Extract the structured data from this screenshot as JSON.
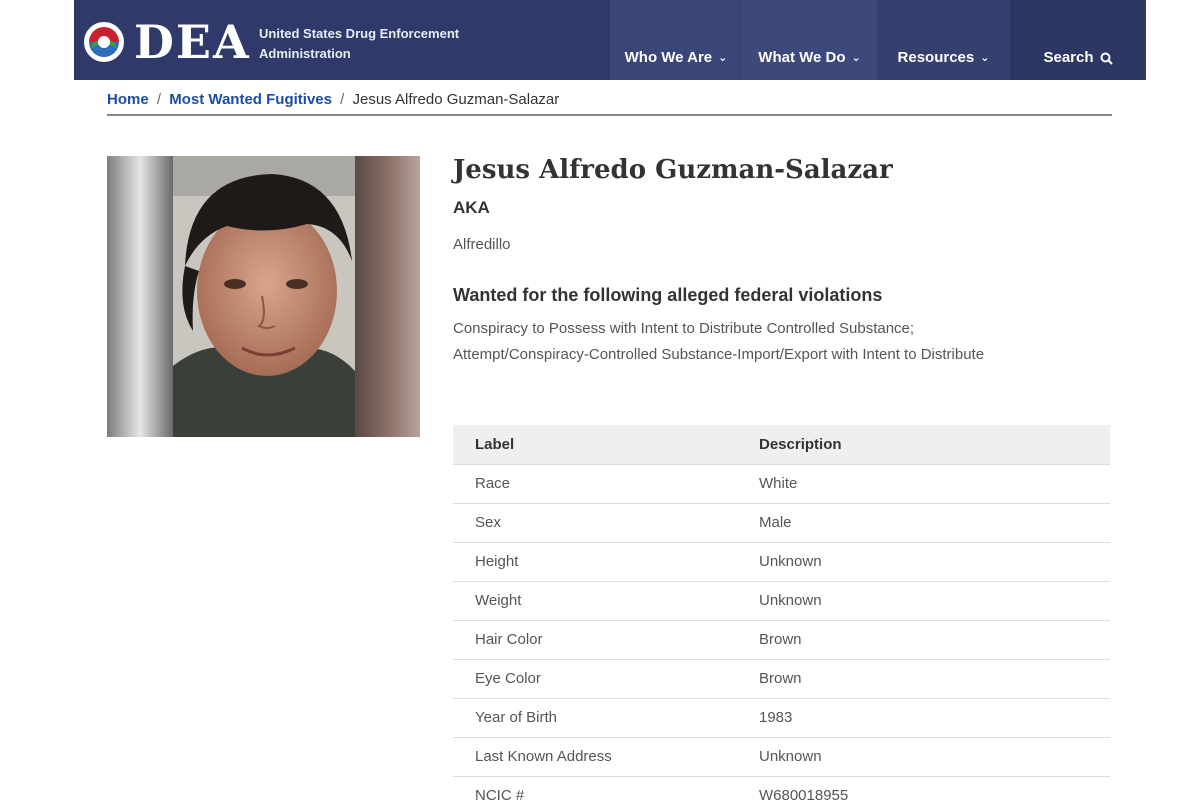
{
  "header": {
    "logo_text": "DEA",
    "agency_line1": "United States Drug Enforcement",
    "agency_line2": "Administration",
    "nav": [
      {
        "label": "Who We Are",
        "icon": "chevron-down-icon"
      },
      {
        "label": "What We Do",
        "icon": "chevron-down-icon"
      },
      {
        "label": "Resources",
        "icon": "chevron-down-icon"
      },
      {
        "label": "Search",
        "icon": "search-icon"
      }
    ]
  },
  "breadcrumb": {
    "home": "Home",
    "section": "Most Wanted Fugitives",
    "current": "Jesus Alfredo Guzman-Salazar",
    "separator": "/"
  },
  "profile": {
    "name": "Jesus Alfredo Guzman-Salazar",
    "aka_heading": "AKA",
    "aka_value": "Alfredillo",
    "wanted_heading": "Wanted for the following alleged federal violations",
    "violations_line1": "Conspiracy to Possess with Intent to Distribute Controlled Substance;",
    "violations_line2": "Attempt/Conspiracy-Controlled Substance-Import/Export with Intent to Distribute"
  },
  "table": {
    "headers": [
      "Label",
      "Description"
    ],
    "rows": [
      [
        "Race",
        "White"
      ],
      [
        "Sex",
        "Male"
      ],
      [
        "Height",
        "Unknown"
      ],
      [
        "Weight",
        "Unknown"
      ],
      [
        "Hair Color",
        "Brown"
      ],
      [
        "Eye Color",
        "Brown"
      ],
      [
        "Year of Birth",
        "1983"
      ],
      [
        "Last Known Address",
        "Unknown"
      ],
      [
        "NCIC #",
        "W680018955"
      ]
    ]
  },
  "colors": {
    "header_bg": "#2f3a6b",
    "link": "#1d4ea3",
    "table_header_bg": "#efefef"
  }
}
